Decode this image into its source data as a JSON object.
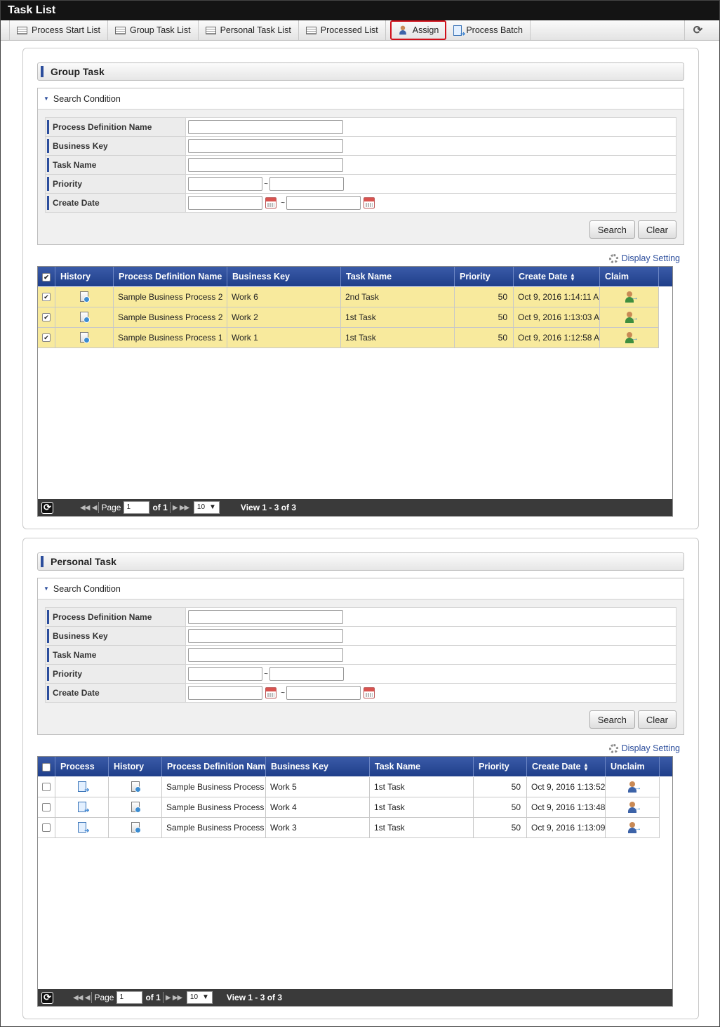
{
  "window": {
    "title": "Task List"
  },
  "tabs": [
    {
      "label": "Process Start List",
      "icon": "list-icon"
    },
    {
      "label": "Group Task List",
      "icon": "list-icon"
    },
    {
      "label": "Personal Task List",
      "icon": "list-icon"
    },
    {
      "label": "Processed List",
      "icon": "list-icon"
    },
    {
      "label": "Assign",
      "icon": "assign-user-icon",
      "active": true
    },
    {
      "label": "Process Batch",
      "icon": "batch-icon"
    }
  ],
  "refresh_glyph": "⟳",
  "accent_color": "#2b4d9c",
  "highlight_color": "#d0101a",
  "group": {
    "title": "Group Task",
    "search": {
      "heading": "Search Condition",
      "labels": {
        "process_definition_name": "Process Definition Name",
        "business_key": "Business Key",
        "task_name": "Task Name",
        "priority": "Priority",
        "create_date": "Create Date"
      },
      "range_sep": "~",
      "search_button": "Search",
      "clear_button": "Clear"
    },
    "display_setting": "Display Setting",
    "headers": {
      "history": "History",
      "process_definition_name": "Process Definition Name",
      "business_key": "Business Key",
      "task_name": "Task Name",
      "priority": "Priority",
      "create_date": "Create Date",
      "claim": "Claim"
    },
    "rows": [
      {
        "process": "Sample Business Process 2",
        "key": "Work 6",
        "task": "2nd Task",
        "priority": "50",
        "date": "Oct 9, 2016 1:14:11 A",
        "checked": true
      },
      {
        "process": "Sample Business Process 2",
        "key": "Work 2",
        "task": "1st Task",
        "priority": "50",
        "date": "Oct 9, 2016 1:13:03 A",
        "checked": true
      },
      {
        "process": "Sample Business Process 1",
        "key": "Work 1",
        "task": "1st Task",
        "priority": "50",
        "date": "Oct 9, 2016 1:12:58 A",
        "checked": true
      }
    ],
    "pager": {
      "page_label": "Page",
      "page": "1",
      "of": "of 1",
      "per_page": "10",
      "view": "View 1 - 3 of 3"
    }
  },
  "personal": {
    "title": "Personal Task",
    "search": {
      "heading": "Search Condition",
      "labels": {
        "process_definition_name": "Process Definition Name",
        "business_key": "Business Key",
        "task_name": "Task Name",
        "priority": "Priority",
        "create_date": "Create Date"
      },
      "range_sep": "~",
      "search_button": "Search",
      "clear_button": "Clear"
    },
    "display_setting": "Display Setting",
    "headers": {
      "process": "Process",
      "history": "History",
      "process_definition_name": "Process Definition Name",
      "business_key": "Business Key",
      "task_name": "Task Name",
      "priority": "Priority",
      "create_date": "Create Date",
      "unclaim": "Unclaim"
    },
    "rows": [
      {
        "process": "Sample Business Process",
        "key": "Work 5",
        "task": "1st Task",
        "priority": "50",
        "date": "Oct 9, 2016 1:13:52",
        "checked": false
      },
      {
        "process": "Sample Business Process",
        "key": "Work 4",
        "task": "1st Task",
        "priority": "50",
        "date": "Oct 9, 2016 1:13:48",
        "checked": false
      },
      {
        "process": "Sample Business Process",
        "key": "Work 3",
        "task": "1st Task",
        "priority": "50",
        "date": "Oct 9, 2016 1:13:09",
        "checked": false
      }
    ],
    "pager": {
      "page_label": "Page",
      "page": "1",
      "of": "of 1",
      "per_page": "10",
      "view": "View 1 - 3 of 3"
    }
  }
}
